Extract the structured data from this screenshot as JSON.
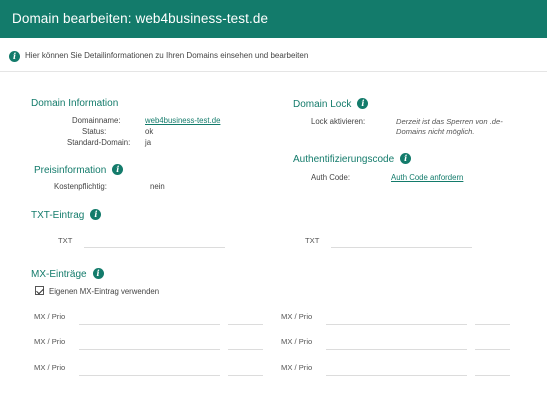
{
  "header": {
    "title": "Domain bearbeiten: web4business-test.de"
  },
  "info": {
    "text": "Hier können Sie Detailinformationen zu Ihren Domains einsehen und bearbeiten"
  },
  "domain_info": {
    "title": "Domain Information",
    "domainname_label": "Domainname:",
    "domainname_value": "web4business-test.de",
    "status_label": "Status:",
    "status_value": "ok",
    "standard_label": "Standard-Domain:",
    "standard_value": "ja"
  },
  "domain_lock": {
    "title": "Domain Lock",
    "lock_label": "Lock aktivieren:",
    "lock_note": "Derzeit ist das Sperren von .de-Domains nicht möglich."
  },
  "price_info": {
    "title": "Preisinformation",
    "cost_label": "Kostenpflichtig:",
    "cost_value": "nein"
  },
  "auth": {
    "title": "Authentifizierungscode",
    "code_label": "Auth Code:",
    "request_link": "Auth Code anfordern"
  },
  "txt": {
    "title": "TXT-Eintrag",
    "label_left": "TXT",
    "label_right": "TXT"
  },
  "mx": {
    "title": "MX-Einträge",
    "checkbox_label": "Eigenen MX-Eintrag verwenden",
    "row_label": "MX / Prio"
  }
}
